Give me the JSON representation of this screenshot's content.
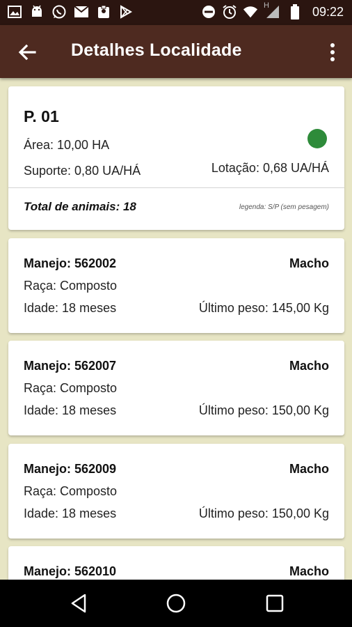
{
  "status_bar": {
    "time": "09:22",
    "left_icons": [
      "image-icon",
      "android-icon",
      "whatsapp-icon",
      "email-icon",
      "clipboard-icon",
      "play-store-icon"
    ],
    "right_icons": [
      "do-not-disturb-icon",
      "alarm-icon",
      "wifi-icon",
      "signal-icon",
      "battery-icon"
    ],
    "network_label": "H"
  },
  "app_bar": {
    "title": "Detalhes Localidade",
    "back_icon": "arrow-back-icon",
    "menu_icon": "more-vert-icon"
  },
  "summary": {
    "title": "P. 01",
    "area": "Área: 10,00 HA",
    "suporte": "Suporte: 0,80 UA/HÁ",
    "lotacao": "Lotação: 0,68 UA/HÁ",
    "total": "Total de animais: 18",
    "legenda": "legenda: S/P (sem pesagem)",
    "status_color": "#2e8b3a"
  },
  "animals": [
    {
      "manejo": "Manejo: 562002",
      "sexo": "Macho",
      "raca": "Raça: Composto",
      "idade": "Idade: 18 meses",
      "peso": "Último peso: 145,00 Kg"
    },
    {
      "manejo": "Manejo: 562007",
      "sexo": "Macho",
      "raca": "Raça: Composto",
      "idade": "Idade: 18 meses",
      "peso": "Último peso: 150,00 Kg"
    },
    {
      "manejo": "Manejo: 562009",
      "sexo": "Macho",
      "raca": "Raça: Composto",
      "idade": "Idade: 18 meses",
      "peso": "Último peso: 150,00 Kg"
    },
    {
      "manejo": "Manejo: 562010",
      "sexo": "Macho"
    }
  ],
  "nav_bar": {
    "back_icon": "nav-back-icon",
    "home_icon": "nav-home-icon",
    "recents_icon": "nav-recents-icon"
  },
  "colors": {
    "status_bar": "#2b1510",
    "app_bar": "#4e2a20",
    "background": "#e7e5c4"
  }
}
